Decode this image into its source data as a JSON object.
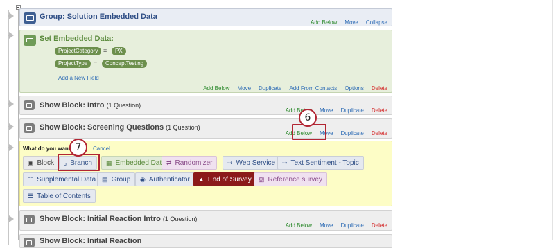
{
  "group_block": {
    "title": "Group: Solution Embedded Data",
    "links": [
      "Add Below",
      "Move",
      "Collapse"
    ]
  },
  "embedded_data": {
    "title": "Set Embedded Data:",
    "fields": [
      {
        "name": "ProjectCategory",
        "op": "=",
        "value": "PX"
      },
      {
        "name": "ProjectType",
        "op": "=",
        "value": "ConceptTesting"
      }
    ],
    "add_field": "Add a New Field",
    "links": [
      "Add Below",
      "Move",
      "Duplicate",
      "Add From Contacts",
      "Options",
      "Delete"
    ]
  },
  "show_intro": {
    "title": "Show Block: Intro",
    "count": "(1 Question)",
    "links": [
      "Add Below",
      "Move",
      "Duplicate",
      "Delete"
    ]
  },
  "show_screening": {
    "title": "Show Block: Screening Questions",
    "count": "(1 Question)",
    "links": [
      "Add Below",
      "Move",
      "Duplicate",
      "Delete"
    ]
  },
  "dialog": {
    "prompt": "What do you want",
    "cancel": "Cancel",
    "options": [
      {
        "label": "Block",
        "icon": "cube-icon"
      },
      {
        "label": "Branch",
        "icon": "branch-icon"
      },
      {
        "label": "Embedded Data",
        "icon": "embedded-data-icon"
      },
      {
        "label": "Randomizer",
        "icon": "shuffle-icon"
      },
      {
        "label": "Web Service",
        "icon": "web-service-icon"
      },
      {
        "label": "Text Sentiment - Topic",
        "icon": "sentiment-icon"
      },
      {
        "label": "Supplemental Data",
        "icon": "database-icon"
      },
      {
        "label": "Group",
        "icon": "folder-icon"
      },
      {
        "label": "Authenticator",
        "icon": "lock-icon"
      },
      {
        "label": "End of Survey",
        "icon": "warning-icon"
      },
      {
        "label": "Reference survey",
        "icon": "survey-icon"
      },
      {
        "label": "Table of Contents",
        "icon": "list-icon"
      }
    ]
  },
  "show_initial": {
    "title": "Show Block: Initial Reaction Intro",
    "count": "(1 Question)",
    "links": [
      "Add Below",
      "Move",
      "Duplicate",
      "Delete"
    ]
  },
  "show_next": {
    "title": "Show Block: Initial Reaction",
    "count": ""
  },
  "callouts": {
    "step6": "6",
    "step7": "7"
  },
  "colors": {
    "accent_red": "#b22533",
    "link_blue": "#2e6cb5",
    "add_green": "#2d8a2d",
    "end_survey": "#8b1a1a"
  }
}
